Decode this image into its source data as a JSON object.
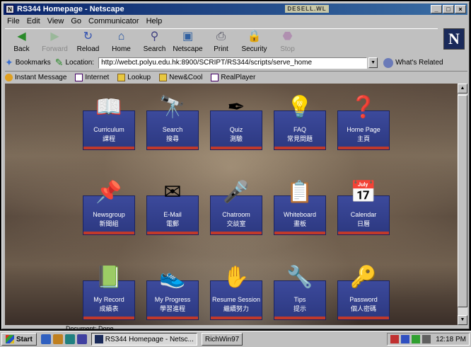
{
  "window": {
    "title": "RS344 Homepage - Netscape",
    "badge": "DESELL.WL",
    "buttons": [
      "_",
      "□",
      "×"
    ]
  },
  "menu": [
    "File",
    "Edit",
    "View",
    "Go",
    "Communicator",
    "Help"
  ],
  "toolbar": [
    {
      "label": "Back",
      "icon": "back-arrow-icon",
      "glyph": "◀",
      "color": "#2a8a2a",
      "enabled": true
    },
    {
      "label": "Forward",
      "icon": "forward-arrow-icon",
      "glyph": "▶",
      "color": "#9ab89a",
      "enabled": false
    },
    {
      "label": "Reload",
      "icon": "reload-icon",
      "glyph": "↻",
      "color": "#3050b0",
      "enabled": true
    },
    {
      "label": "Home",
      "icon": "home-icon",
      "glyph": "⌂",
      "color": "#2050a0",
      "enabled": true
    },
    {
      "label": "Search",
      "icon": "search-icon",
      "glyph": "⚲",
      "color": "#404080",
      "enabled": true
    },
    {
      "label": "Netscape",
      "icon": "netscape-icon",
      "glyph": "▣",
      "color": "#3060a0",
      "enabled": true
    },
    {
      "label": "Print",
      "icon": "print-icon",
      "glyph": "⎙",
      "color": "#505060",
      "enabled": true
    },
    {
      "label": "Security",
      "icon": "security-lock-icon",
      "glyph": "🔒",
      "color": "#a04040",
      "enabled": true
    },
    {
      "label": "Stop",
      "icon": "stop-icon",
      "glyph": "⬣",
      "color": "#b090b0",
      "enabled": false
    }
  ],
  "location": {
    "bookmarks_label": "Bookmarks",
    "location_label": "Location:",
    "url": "http://webct.polyu.edu.hk:8900/SCRIPT/RS344/scripts/serve_home",
    "related_label": "What's Related"
  },
  "personal_toolbar": [
    "Instant Message",
    "Internet",
    "Lookup",
    "New&Cool",
    "RealPlayer"
  ],
  "tiles": [
    {
      "en": "Curriculum",
      "zh": "課程",
      "icon": "open-book-icon",
      "glyph": "📖"
    },
    {
      "en": "Search",
      "zh": "搜尋",
      "icon": "binoculars-icon",
      "glyph": "🔭"
    },
    {
      "en": "Quiz",
      "zh": "測驗",
      "icon": "pen-icon",
      "glyph": "✒"
    },
    {
      "en": "FAQ",
      "zh": "常見問題",
      "icon": "lightbulb-icon",
      "glyph": "💡"
    },
    {
      "en": "Home Page",
      "zh": "主頁",
      "icon": "person-question-icon",
      "glyph": "❓"
    },
    {
      "en": "Newsgroup",
      "zh": "新聞組",
      "icon": "pushpin-icon",
      "glyph": "📌"
    },
    {
      "en": "E-Mail",
      "zh": "電郵",
      "icon": "envelope-icon",
      "glyph": "✉"
    },
    {
      "en": "Chatroom",
      "zh": "交談室",
      "icon": "microphone-icon",
      "glyph": "🎤"
    },
    {
      "en": "Whiteboard",
      "zh": "畫板",
      "icon": "whiteboard-icon",
      "glyph": "📋"
    },
    {
      "en": "Calendar",
      "zh": "日曆",
      "icon": "calendar-icon",
      "glyph": "📅"
    },
    {
      "en": "My Record",
      "zh": "成績表",
      "icon": "record-book-icon",
      "glyph": "📗"
    },
    {
      "en": "My Progress",
      "zh": "學習進程",
      "icon": "sneakers-icon",
      "glyph": "👟"
    },
    {
      "en": "Resume Session",
      "zh": "繼續努力",
      "icon": "hand-icon",
      "glyph": "✋"
    },
    {
      "en": "Tips",
      "zh": "提示",
      "icon": "clamp-icon",
      "glyph": "🔧"
    },
    {
      "en": "Password",
      "zh": "個人密碼",
      "icon": "keys-icon",
      "glyph": "🔑"
    }
  ],
  "status": {
    "text": "Document: Done"
  },
  "taskbar": {
    "start": "Start",
    "tasks": [
      "RS344 Homepage - Netsc...",
      "RichWin97"
    ],
    "clock": "12:18 PM"
  }
}
